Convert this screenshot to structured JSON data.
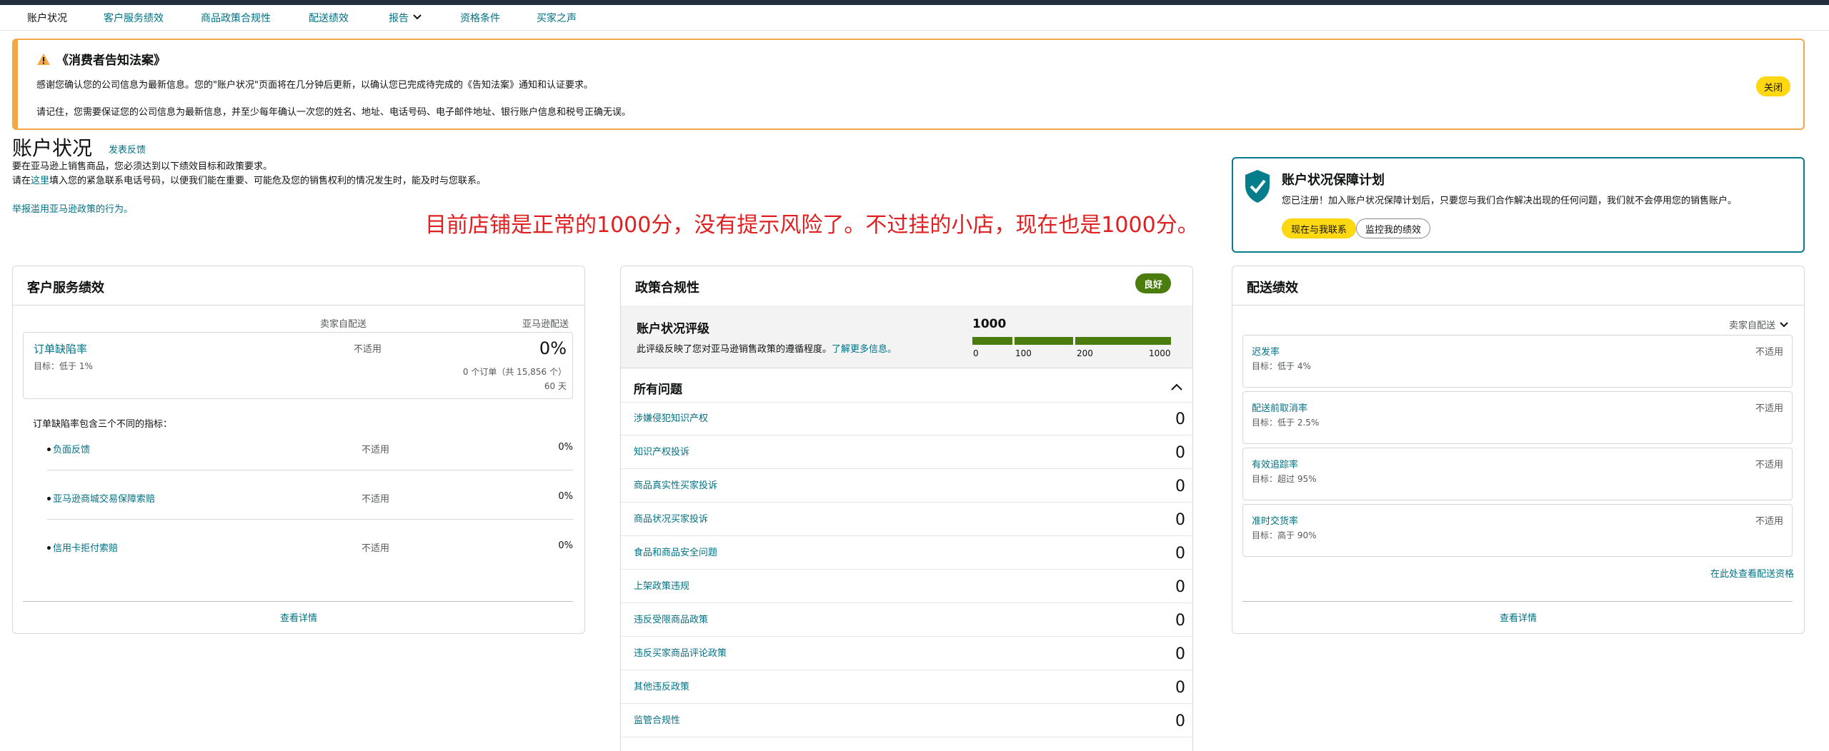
{
  "nav": {
    "items": [
      {
        "label": "账户状况"
      },
      {
        "label": "客户服务绩效"
      },
      {
        "label": "商品政策合规性"
      },
      {
        "label": "配送绩效"
      },
      {
        "label": "报告"
      },
      {
        "label": "资格条件"
      },
      {
        "label": "买家之声"
      }
    ]
  },
  "alert": {
    "title": "《消费者告知法案》",
    "line1": "感谢您确认您的公司信息为最新信息。您的\"账户状况\"页面将在几分钟后更新，以确认您已完成待完成的《告知法案》通知和认证要求。",
    "line2": "请记住，您需要保证您的公司信息为最新信息，并至少每年确认一次您的姓名、地址、电话号码、电子邮件地址、银行账户信息和税号正确无误。",
    "close_label": "关闭"
  },
  "page": {
    "title": "账户状况",
    "feedback_link": "发表反馈",
    "req_line1": "要在亚马逊上销售商品，您必须达到以下绩效目标和政策要求。",
    "req_line2_pre": "请在",
    "req_line2_link": "这里",
    "req_line2_post": "填入您的紧急联系电话号码，以便我们能在重要、可能危及您的销售权利的情况发生时，能及时与您联系。",
    "report_link": "举报滥用亚马逊政策的行为。",
    "annotation": "目前店铺是正常的1000分，没有提示风险了。不过挂的小店，现在也是1000分。"
  },
  "protection": {
    "title": "账户状况保障计划",
    "desc": "您已注册！加入账户状况保障计划后，只要您与我们合作解决出现的任何问题，我们就不会停用您的销售账户。",
    "contact_button": "现在与我联系",
    "monitor_button": "监控我的绩效"
  },
  "customer_service": {
    "title": "客户服务绩效",
    "col_seller": "卖家自配送",
    "col_amazon": "亚马逊配送",
    "odr": {
      "name": "订单缺陷率",
      "target": "目标：低于 1%",
      "seller_value": "不适用",
      "amazon_value": "0%",
      "orders": "0 个订单（共 15,856 个）",
      "days": "60 天"
    },
    "intro": "订单缺陷率包含三个不同的指标：",
    "metrics": [
      {
        "name": "负面反馈",
        "seller": "不适用",
        "amazon": "0%"
      },
      {
        "name": "亚马逊商城交易保障索赔",
        "seller": "不适用",
        "amazon": "0%"
      },
      {
        "name": "信用卡拒付索赔",
        "seller": "不适用",
        "amazon": "0%"
      }
    ],
    "details_link": "查看详情"
  },
  "policy": {
    "title": "政策合规性",
    "badge": "良好",
    "ahr_title": "账户状况评级",
    "ahr_desc": "此评级反映了您对亚马逊销售政策的遵循程度。",
    "ahr_link": "了解更多信息。",
    "score": "1000",
    "scale": [
      "0",
      "100",
      "200",
      "1000"
    ],
    "issues_title": "所有问题",
    "issues": [
      {
        "label": "涉嫌侵犯知识产权",
        "value": "0"
      },
      {
        "label": "知识产权投诉",
        "value": "0"
      },
      {
        "label": "商品真实性买家投诉",
        "value": "0"
      },
      {
        "label": "商品状况买家投诉",
        "value": "0"
      },
      {
        "label": "食品和商品安全问题",
        "value": "0"
      },
      {
        "label": "上架政策违规",
        "value": "0"
      },
      {
        "label": "违反受限商品政策",
        "value": "0"
      },
      {
        "label": "违反买家商品评论政策",
        "value": "0"
      },
      {
        "label": "其他违反政策",
        "value": "0"
      },
      {
        "label": "监管合规性",
        "value": "0"
      }
    ]
  },
  "shipping": {
    "title": "配送绩效",
    "dropdown": "卖家自配送",
    "metrics": [
      {
        "name": "迟发率",
        "target": "目标：低于 4%",
        "value": "不适用"
      },
      {
        "name": "配送前取消率",
        "target": "目标：低于 2.5%",
        "value": "不适用"
      },
      {
        "name": "有效追踪率",
        "target": "目标：超过 95%",
        "value": "不适用"
      },
      {
        "name": "准时交货率",
        "target": "目标：高于 90%",
        "value": "不适用"
      }
    ],
    "eligibility_link": "在此处查看配送资格",
    "details_link": "查看详情"
  }
}
